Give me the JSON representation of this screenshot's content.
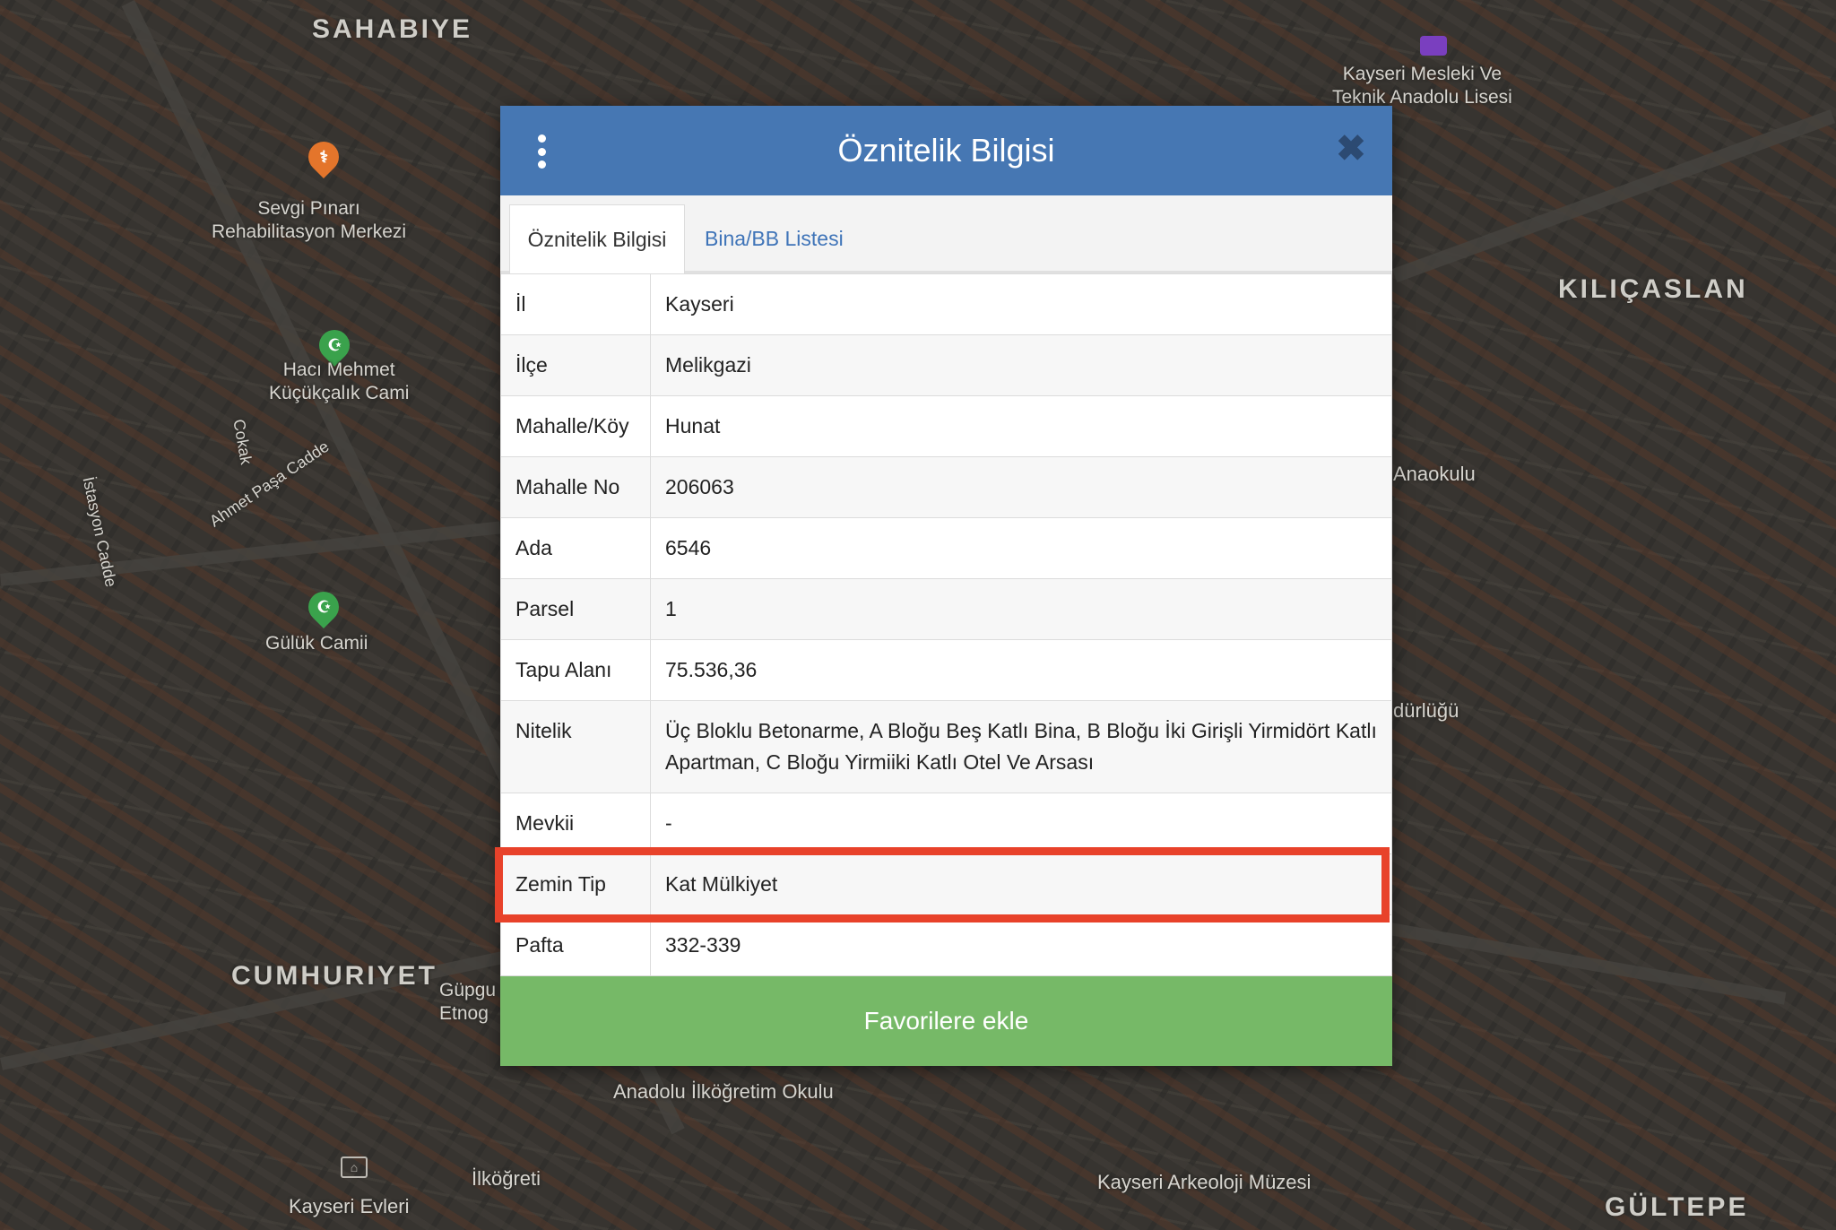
{
  "map": {
    "labels": {
      "sahabiye": "SAHABIYE",
      "kilicaslan": "KILIÇASLAN",
      "cumhuriyet": "CUMHURIYET",
      "gultepe": "GÜLTEPE",
      "sevgi_pinari": "Sevgi Pınarı\nRehabilitasyon Merkezi",
      "haci_mehmet": "Hacı Mehmet\nKüçükçalık Cami",
      "guluk_camii": "Gülük Camii",
      "kayseri_meslek": "Kayseri Mesleki Ve\nTeknik Anadolu Lisesi",
      "anaokulu": "Anaokulu",
      "durlugu": "dürlüğü",
      "gupgu": "Güpgu\nEtnog",
      "anadolu_ilkogretim": "Anadolu İlköğretim Okulu",
      "ilkogreti": "İlköğreti",
      "kayseri_evleri": "Kayseri Evleri",
      "kayseri_arkeoloji": "Kayseri Arkeoloji Müzesi",
      "istasyon_cadde": "İstasyon Cadde",
      "sokak": "Cokak",
      "ahmet_pasa": "Ahmet Paşa Cadde"
    },
    "icons": {
      "mosque": "mosque-pin-icon",
      "medical": "medical-pin-icon",
      "school": "school-pin-icon",
      "museum": "museum-icon"
    }
  },
  "dialog": {
    "title": "Öznitelik Bilgisi",
    "tabs": [
      {
        "label": "Öznitelik Bilgisi",
        "active": true
      },
      {
        "label": "Bina/BB Listesi",
        "active": false
      }
    ],
    "rows": [
      {
        "key": "İl",
        "value": "Kayseri"
      },
      {
        "key": "İlçe",
        "value": "Melikgazi"
      },
      {
        "key": "Mahalle/Köy",
        "value": "Hunat"
      },
      {
        "key": "Mahalle No",
        "value": "206063"
      },
      {
        "key": "Ada",
        "value": "6546"
      },
      {
        "key": "Parsel",
        "value": "1"
      },
      {
        "key": "Tapu Alanı",
        "value": "75.536,36"
      },
      {
        "key": "Nitelik",
        "value": "Üç Bloklu Betonarme, A Bloğu Beş Katlı Bina, B Bloğu İki Girişli Yirmidört Katlı Apartman, C Bloğu Yirmiiki Katlı Otel Ve Arsası"
      },
      {
        "key": "Mevkii",
        "value": "-"
      },
      {
        "key": "Zemin Tip",
        "value": "Kat Mülkiyet"
      },
      {
        "key": "Pafta",
        "value": "332-339"
      }
    ],
    "highlighted_row": "Zemin Tip",
    "favorite_button": "Favorilere ekle",
    "colors": {
      "header": "#4677b3",
      "tab_link": "#3f74b8",
      "button": "#76b967",
      "highlight": "#e8422a"
    }
  }
}
